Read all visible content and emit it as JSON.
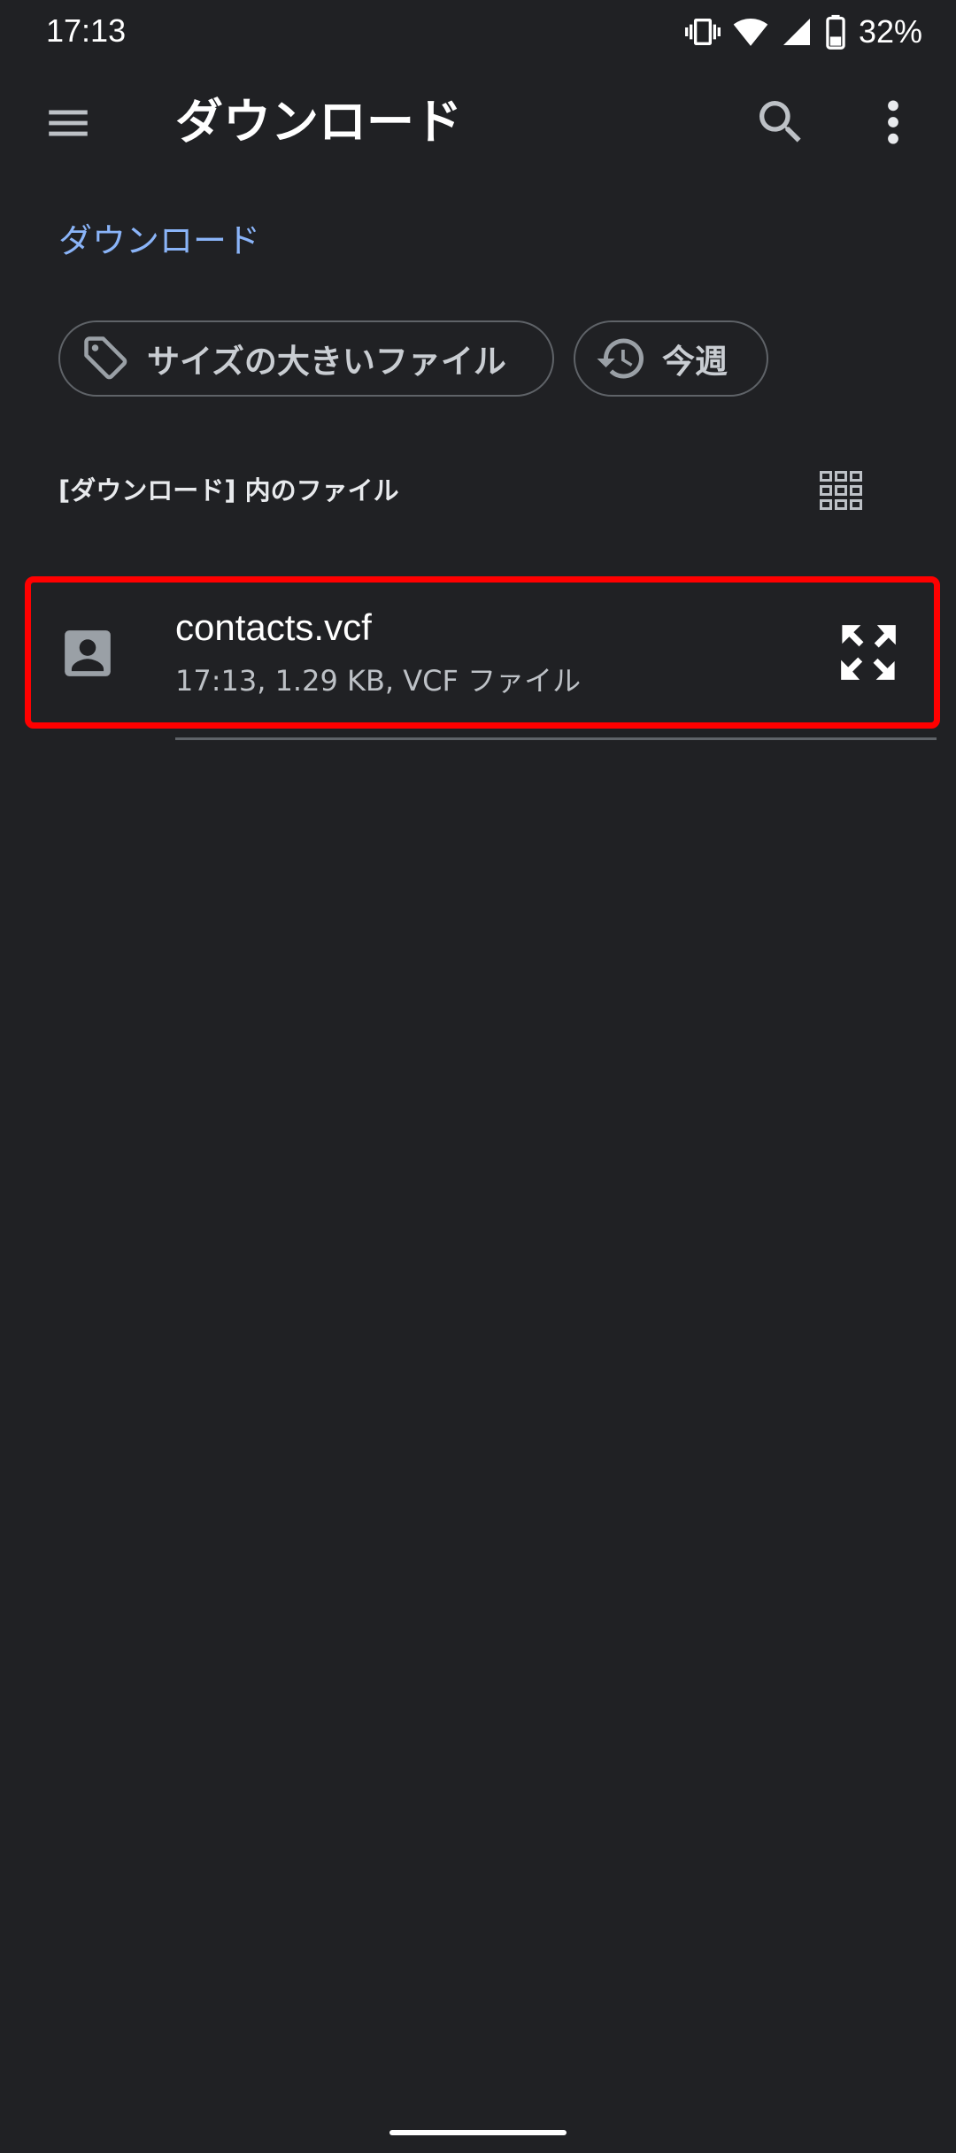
{
  "status_bar": {
    "time": "17:13",
    "battery": "32%"
  },
  "app_bar": {
    "title": "ダウンロード",
    "icons": [
      "menu-icon",
      "search-icon",
      "more-vert-icon"
    ]
  },
  "breadcrumb": "ダウンロード",
  "filters": [
    {
      "label": "サイズの大きいファイル",
      "icon": "label-tag-icon"
    },
    {
      "label": "今週",
      "icon": "history-icon"
    }
  ],
  "section": {
    "header": "[ダウンロード] 内のファイル",
    "view_toggle_icon": "grid-view-icon"
  },
  "files": [
    {
      "name": "contacts.vcf",
      "meta": "17:13, 1.29 KB, VCF ファイル",
      "icon": "contact-card-icon",
      "action_icon": "expand-icon"
    }
  ],
  "colors": {
    "background": "#202124",
    "accent": "#8ab4f8",
    "highlight": "#ff0000"
  }
}
